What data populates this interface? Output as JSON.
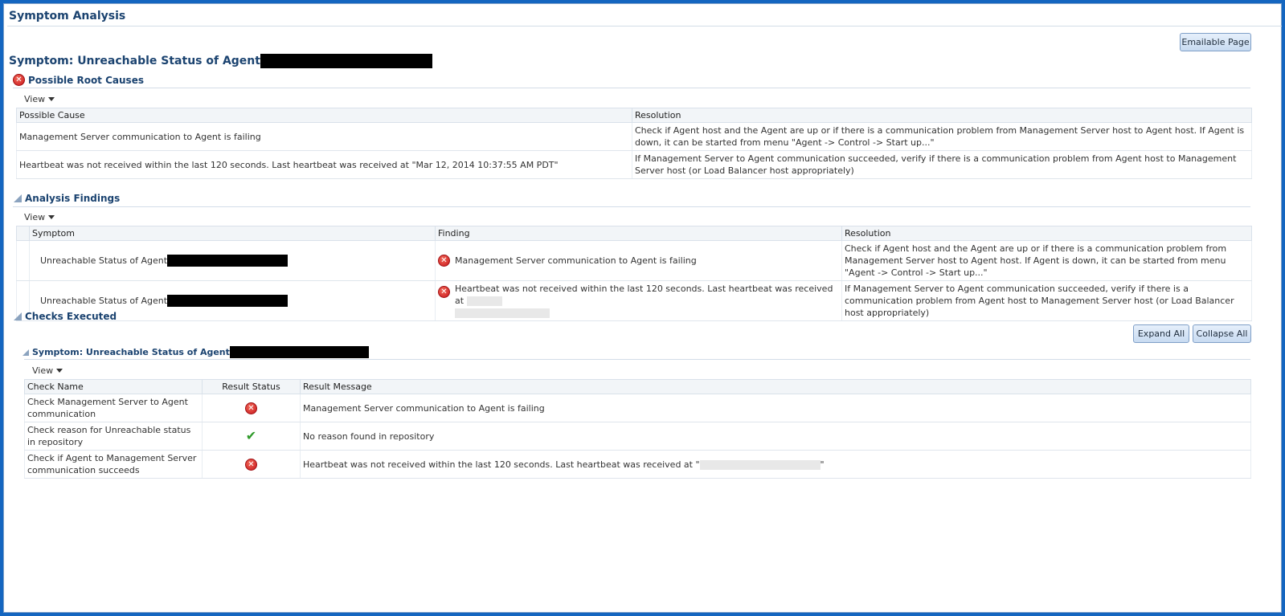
{
  "page": {
    "title": "Symptom Analysis",
    "emailable_label": "Emailable Page"
  },
  "symptom": {
    "title": "Symptom: Unreachable Status of Agent"
  },
  "root_causes": {
    "heading": "Possible Root Causes",
    "view_label": "View",
    "columns": [
      "Possible Cause",
      "Resolution"
    ],
    "rows": [
      {
        "cause": "Management Server communication to Agent is failing",
        "resolution": "Check if Agent host and the Agent are up or if there is a communication problem from Management Server host to Agent host. If Agent is down, it can be started from menu \"Agent -> Control -> Start up...\""
      },
      {
        "cause": "Heartbeat was not received within the last 120 seconds. Last heartbeat was received at \"Mar 12, 2014 10:37:55 AM PDT\"",
        "resolution": "If Management Server to Agent communication succeeded, verify if there is a communication problem from Agent host to Management Server host (or Load Balancer host appropriately)"
      }
    ]
  },
  "analysis": {
    "heading": "Analysis Findings",
    "view_label": "View",
    "columns": [
      "Symptom",
      "Finding",
      "Resolution"
    ],
    "rows": [
      {
        "symptom": "Unreachable Status of Agent",
        "finding": "Management Server communication to Agent is failing",
        "resolution": "Check if Agent host and the Agent are up or if there is a communication problem from Management Server host to Agent host. If Agent is down, it can be started from menu \"Agent -> Control -> Start up...\""
      },
      {
        "symptom": "Unreachable Status of Agent",
        "finding": "Heartbeat was not received within the last 120 seconds. Last heartbeat was received at",
        "resolution": "If Management Server to Agent communication succeeded, verify if there is a communication problem from Agent host to Management Server host (or Load Balancer host appropriately)"
      }
    ]
  },
  "checks": {
    "heading": "Checks Executed",
    "expand_all": "Expand All",
    "collapse_all": "Collapse All",
    "sub_heading": "Symptom: Unreachable Status of Agent",
    "view_label": "View",
    "columns": [
      "Check Name",
      "Result Status",
      "Result Message"
    ],
    "rows": [
      {
        "name": "Check Management Server to Agent communication",
        "status": "error",
        "message": "Management Server communication to Agent is failing"
      },
      {
        "name": "Check reason for Unreachable status in repository",
        "status": "success",
        "message": "No reason found in repository"
      },
      {
        "name": "Check if Agent to Management Server communication succeeds",
        "status": "error",
        "message": "Heartbeat was not received within the last 120 seconds. Last heartbeat was received at \"",
        "message_suffix": "\""
      }
    ]
  },
  "colors": {
    "frame": "#1466c0",
    "heading": "#1b4370",
    "error": "#c8161b",
    "success": "#2f9a2a"
  }
}
